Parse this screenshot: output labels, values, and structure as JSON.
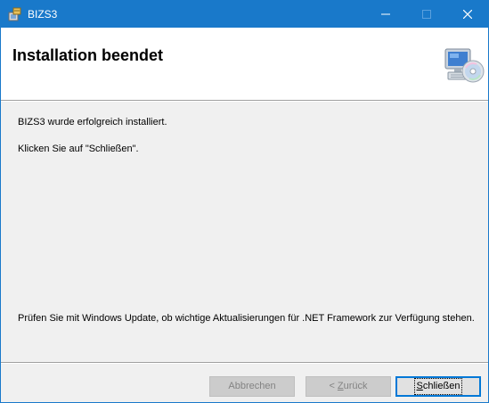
{
  "window": {
    "title": "BIZS3",
    "icon": "installer-icon",
    "accent_color": "#1979ca",
    "controls": {
      "minimize": "—",
      "maximize": "☐",
      "close": "✕"
    }
  },
  "header": {
    "title": "Installation beendet",
    "image": "computer-cd-icon"
  },
  "content": {
    "line1": "BIZS3 wurde erfolgreich installiert.",
    "line2": "Klicken Sie auf \"Schließen\".",
    "footnote": "Prüfen Sie mit Windows Update, ob wichtige Aktualisierungen für .NET Framework zur Verfügung stehen."
  },
  "buttons": {
    "cancel": {
      "label": "Abbrechen",
      "enabled": false
    },
    "back": {
      "prefix": "< ",
      "mnemonic": "Z",
      "rest": "urück",
      "enabled": false
    },
    "close": {
      "mnemonic": "S",
      "rest": "chließen",
      "enabled": true,
      "default": true
    }
  }
}
